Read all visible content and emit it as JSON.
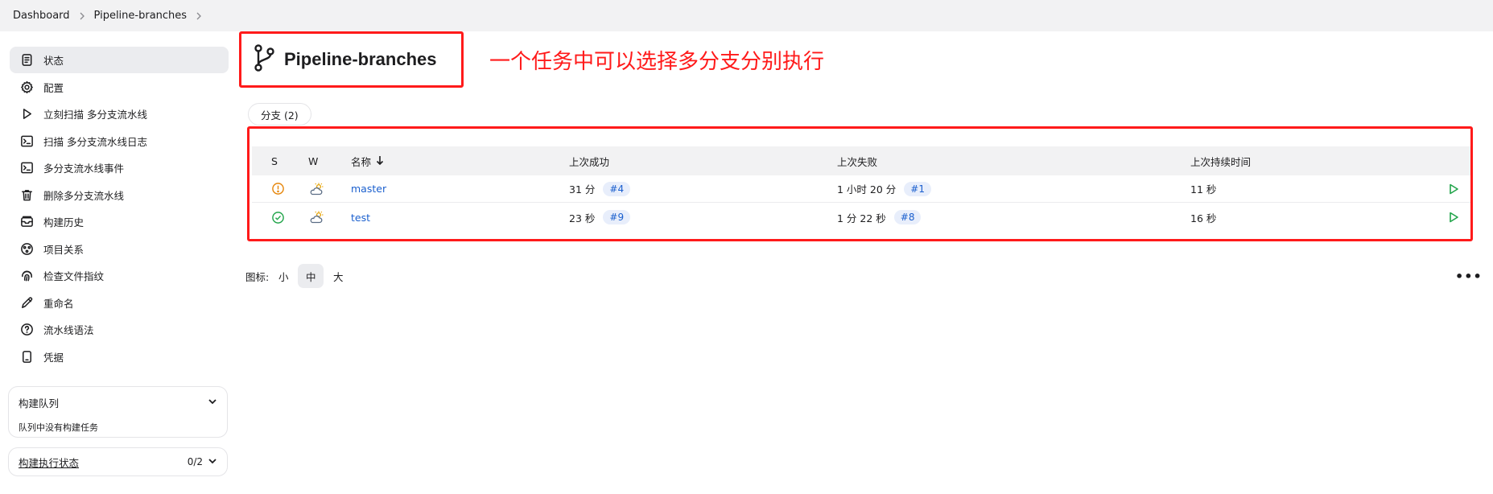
{
  "breadcrumb": {
    "items": [
      "Dashboard",
      "Pipeline-branches"
    ]
  },
  "sidebar": {
    "items": [
      {
        "label": "状态",
        "icon": "document-icon"
      },
      {
        "label": "配置",
        "icon": "gear-icon"
      },
      {
        "label": "立刻扫描 多分支流水线",
        "icon": "play-icon"
      },
      {
        "label": "扫描 多分支流水线日志",
        "icon": "terminal-icon"
      },
      {
        "label": "多分支流水线事件",
        "icon": "terminal-icon"
      },
      {
        "label": "删除多分支流水线",
        "icon": "trash-icon"
      },
      {
        "label": "构建历史",
        "icon": "history-icon"
      },
      {
        "label": "项目关系",
        "icon": "relation-icon"
      },
      {
        "label": "检查文件指纹",
        "icon": "fingerprint-icon"
      },
      {
        "label": "重命名",
        "icon": "pencil-icon"
      },
      {
        "label": "流水线语法",
        "icon": "help-icon"
      },
      {
        "label": "凭据",
        "icon": "credentials-icon"
      }
    ]
  },
  "queue": {
    "title": "构建队列",
    "empty_text": "队列中没有构建任务"
  },
  "executors": {
    "title": "构建执行状态",
    "count": "0/2"
  },
  "page": {
    "title": "Pipeline-branches",
    "annotation": "一个任务中可以选择多分支分别执行",
    "tab_label": "分支 (2)"
  },
  "table": {
    "headers": {
      "s": "S",
      "w": "W",
      "name": "名称",
      "last_success": "上次成功",
      "last_failure": "上次失败",
      "last_duration": "上次持续时间"
    },
    "rows": [
      {
        "status": "unstable",
        "status_color": "#e6860b",
        "name": "master",
        "last_success": "31 分",
        "success_build": "#4",
        "last_failure": "1 小时 20 分",
        "failure_build": "#1",
        "duration": "11 秒"
      },
      {
        "status": "success",
        "status_color": "#21a44a",
        "name": "test",
        "last_success": "23 秒",
        "success_build": "#9",
        "last_failure": "1 分 22 秒",
        "failure_build": "#8",
        "duration": "16 秒"
      }
    ]
  },
  "icon_size": {
    "label": "图标:",
    "options": [
      "小",
      "中",
      "大"
    ],
    "selected": "中"
  },
  "more_label": "•••",
  "colors": {
    "accent": "#1a5fce",
    "annotation_red": "#ff1a1a",
    "success": "#21a44a",
    "warning": "#e6860b"
  }
}
